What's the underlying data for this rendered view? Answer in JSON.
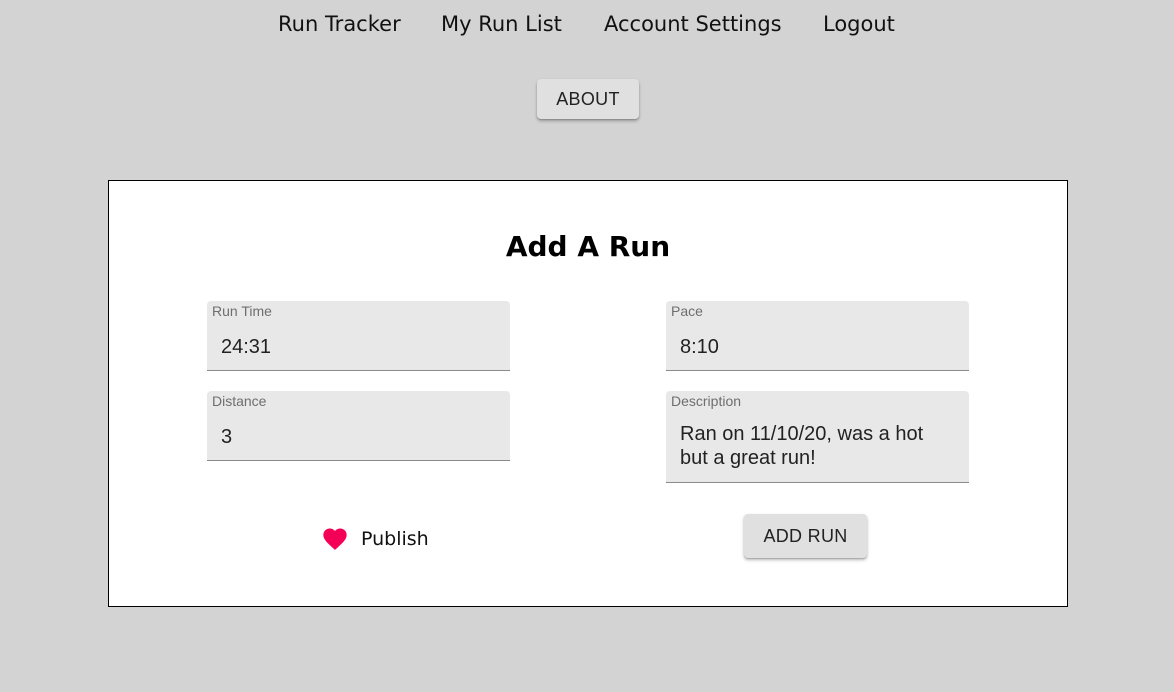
{
  "nav": {
    "items": [
      {
        "label": "Run Tracker"
      },
      {
        "label": "My Run List"
      },
      {
        "label": "Account Settings"
      },
      {
        "label": "Logout"
      }
    ]
  },
  "about_button": {
    "label": "ABOUT"
  },
  "form": {
    "title": "Add A Run",
    "fields": {
      "run_time": {
        "label": "Run Time",
        "value": "24:31"
      },
      "pace": {
        "label": "Pace",
        "value": "8:10"
      },
      "distance": {
        "label": "Distance",
        "value": "3"
      },
      "description": {
        "label": "Description",
        "value": "Ran on 11/10/20, was a hot but a great run!"
      }
    },
    "publish": {
      "label": "Publish",
      "icon": "heart-icon",
      "checked": true
    },
    "submit": {
      "label": "ADD RUN"
    }
  },
  "colors": {
    "background": "#d3d3d3",
    "card": "#ffffff",
    "field_bg": "#e8e8e8",
    "button_bg": "#e0e0e0",
    "heart": "#f50057"
  }
}
